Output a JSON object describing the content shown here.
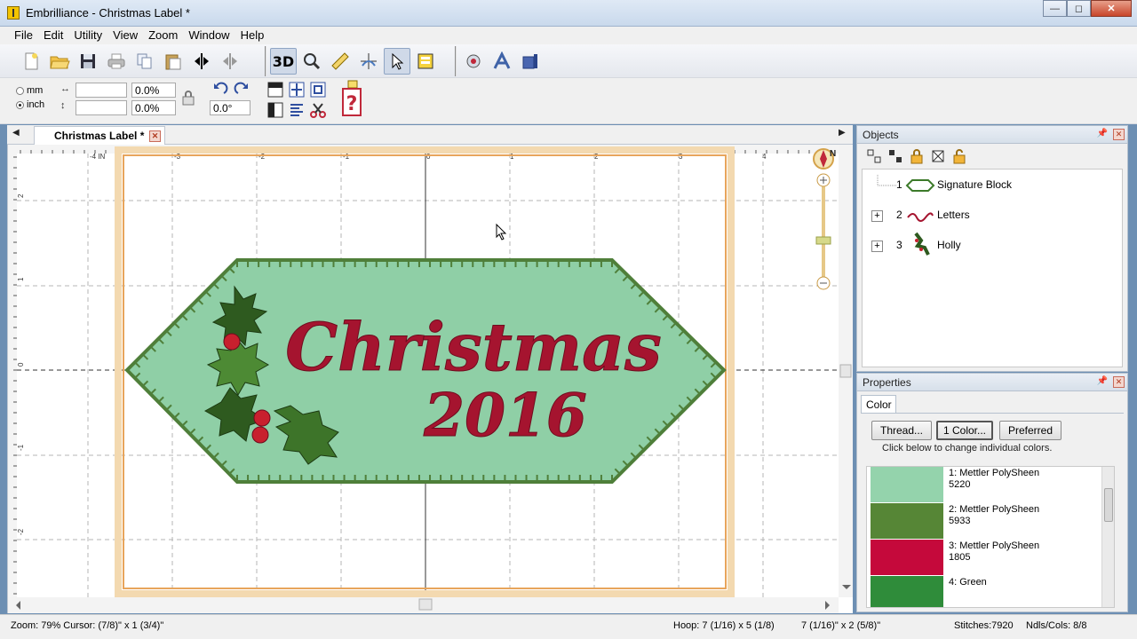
{
  "window": {
    "title": "Embrilliance - Christmas Label *"
  },
  "menu": [
    "File",
    "Edit",
    "Utility",
    "View",
    "Zoom",
    "Window",
    "Help"
  ],
  "toolbar": {
    "btn_3d": "3D"
  },
  "units": {
    "mm_label": "mm",
    "inch_label": "inch",
    "selected": "inch"
  },
  "fields": {
    "width_value": "",
    "height_value": "",
    "width_pct": "0.0%",
    "height_pct": "0.0%",
    "rotation": "0.0°"
  },
  "document_tab": {
    "label": "Christmas Label *"
  },
  "ruler": {
    "top_labels": [
      "-4 IN",
      "-3",
      "-2",
      "-1",
      "0",
      "1",
      "2",
      "3",
      "4"
    ],
    "left_labels": [
      "2",
      "1",
      "0",
      "-1",
      "-2"
    ]
  },
  "design": {
    "line1": "Christmas",
    "line2": "2016",
    "fabric_color": "#8fcfa6",
    "border_color": "#4f7f3a",
    "text_color": "#a5142f",
    "holly_dark": "#2e5a1f",
    "holly_light": "#4d8a34",
    "berry_color": "#c8202e"
  },
  "zoom_widget": {
    "compass_label": "N"
  },
  "objects_panel": {
    "title": "Objects",
    "items": [
      {
        "num": "1",
        "name": "Signature Block",
        "expandable": false
      },
      {
        "num": "2",
        "name": "Letters",
        "expandable": true
      },
      {
        "num": "3",
        "name": "Holly",
        "expandable": true
      }
    ]
  },
  "properties_panel": {
    "title": "Properties",
    "tab": "Color",
    "buttons": {
      "thread": "Thread...",
      "one_color": "1 Color...",
      "preferred": "Preferred"
    },
    "note": "Click below to change individual colors.",
    "colors": [
      {
        "line1": "1: Mettler PolySheen",
        "line2": "5220",
        "swatch": "#94d3ac"
      },
      {
        "line1": "2: Mettler PolySheen",
        "line2": "5933",
        "swatch": "#568636"
      },
      {
        "line1": "3: Mettler PolySheen",
        "line2": "1805",
        "swatch": "#c5093b"
      },
      {
        "line1": "4: Green",
        "line2": "",
        "swatch": "#2f8c3a"
      }
    ]
  },
  "status": {
    "zoom_cursor": "Zoom: 79%  Cursor: (7/8)\" x 1 (3/4)\"",
    "hoop": "Hoop: 7 (1/16) x 5 (1/8)",
    "size": "7 (1/16)\" x 2 (5/8)\"",
    "stitches": "Stitches:7920",
    "ndls": "Ndls/Cols: 8/8"
  }
}
